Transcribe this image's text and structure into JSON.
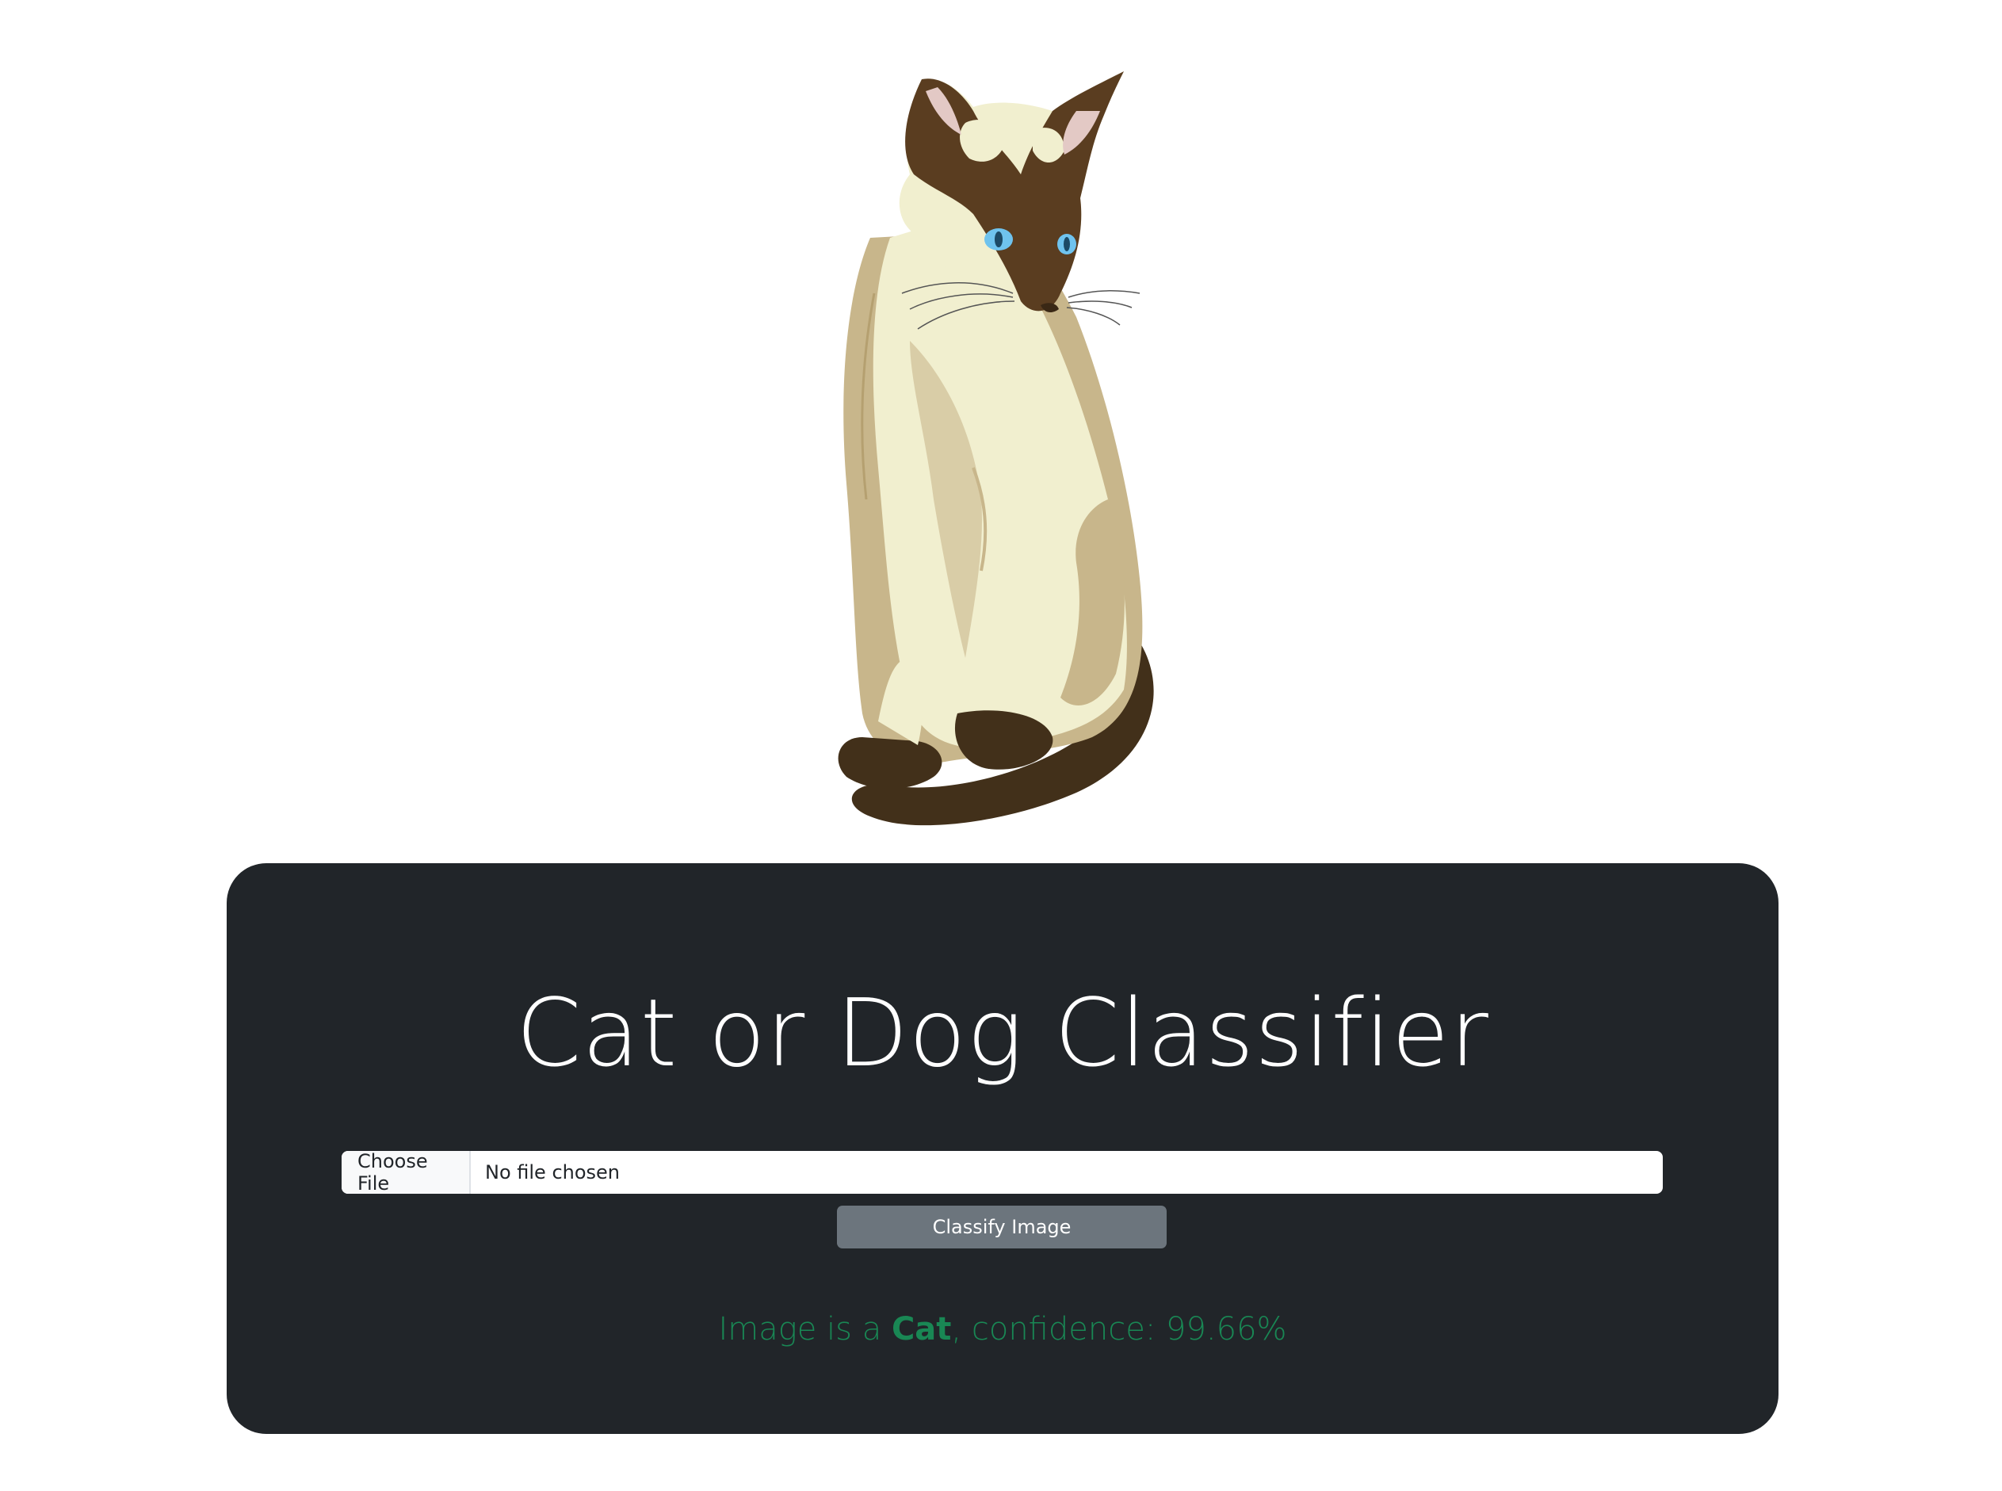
{
  "card": {
    "title": "Cat or Dog Classifier",
    "file_input": {
      "button_label": "Choose File",
      "file_name": "No file chosen"
    },
    "classify_button": "Classify Image",
    "result": {
      "prefix": "Image is a ",
      "label": "Cat",
      "suffix": ", confidence: 99.66%"
    }
  },
  "colors": {
    "card_background": "#212529",
    "result_text": "#198754",
    "button_secondary": "#6c757d"
  }
}
